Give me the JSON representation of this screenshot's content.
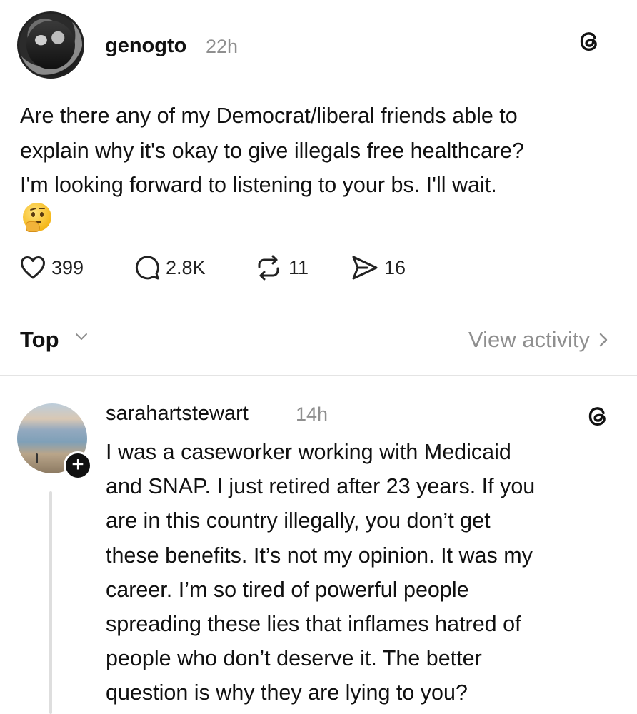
{
  "post": {
    "username": "genogto",
    "time": "22h",
    "text": "Are there any of my Democrat/liberal friends able to\nexplain why it's okay to give illegals free healthcare?\nI'm looking forward to listening to your bs. I'll wait.",
    "emoji": "thinking-face-emoji",
    "actions": {
      "likes": "399",
      "replies": "2.8K",
      "reposts": "11",
      "shares": "16"
    }
  },
  "sort": {
    "label": "Top",
    "view_activity": "View activity"
  },
  "reply": {
    "username": "sarahartstewart",
    "time": "14h",
    "follow_symbol": "+",
    "text": "I was a caseworker working with Medicaid\nand SNAP. I just retired after 23 years. If you\nare in this country illegally, you don’t get\nthese benefits. It’s not my opinion. It was my\ncareer. I’m so tired of powerful people\nspreading these lies that inflames hatred of\npeople who don’t deserve it. The better\nquestion is why they are lying to you?"
  },
  "icons": {
    "threads": "threads-logo-icon",
    "like": "heart-icon",
    "reply": "speech-bubble-icon",
    "repost": "repost-icon",
    "share": "paper-plane-icon",
    "sort": "chevron-down-icon",
    "view": "chevron-right-icon"
  },
  "colors": {
    "text": "#111111",
    "muted": "#8f8f8f",
    "divider": "#e4e4e4"
  }
}
